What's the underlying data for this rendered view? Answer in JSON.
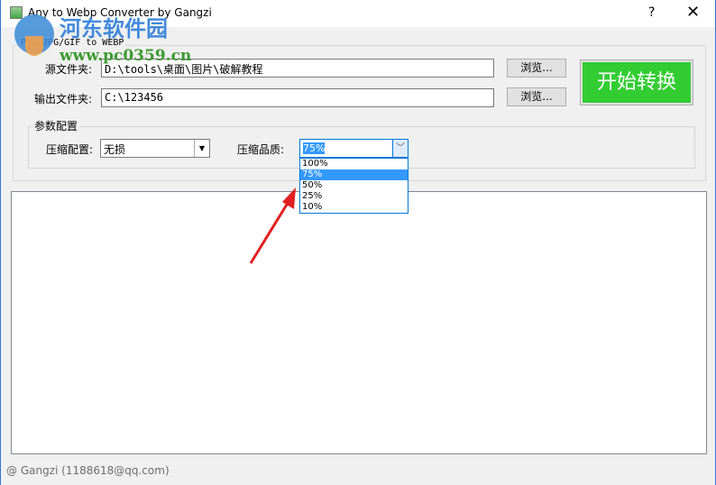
{
  "window": {
    "title": "Any to Webp Converter by Gangzi",
    "help": "?",
    "close": "✕"
  },
  "watermark": {
    "name": "河东软件园",
    "url": "www.pc0359.cn"
  },
  "main_group": {
    "label": "PNG/JPG/GIF to WEBP"
  },
  "source": {
    "label": "源文件夹:",
    "value": "D:\\tools\\桌面\\图片\\破解教程",
    "browse": "浏览..."
  },
  "output": {
    "label": "输出文件夹:",
    "value": "C:\\123456",
    "browse": "浏览..."
  },
  "start_button": "开始转换",
  "params": {
    "label": "参数配置",
    "compress_mode_label": "压缩配置:",
    "compress_mode_value": "无损",
    "quality_label": "压缩品质:",
    "quality_value": "75%",
    "quality_options": [
      "100%",
      "75%",
      "50%",
      "25%",
      "10%"
    ],
    "selected_index": 1
  },
  "status": "@ Gangzi (1188618@qq.com)",
  "colors": {
    "start": "#33cc33",
    "accent": "#0078d7",
    "highlight": "#3399ff",
    "arrow": "#e02020"
  }
}
